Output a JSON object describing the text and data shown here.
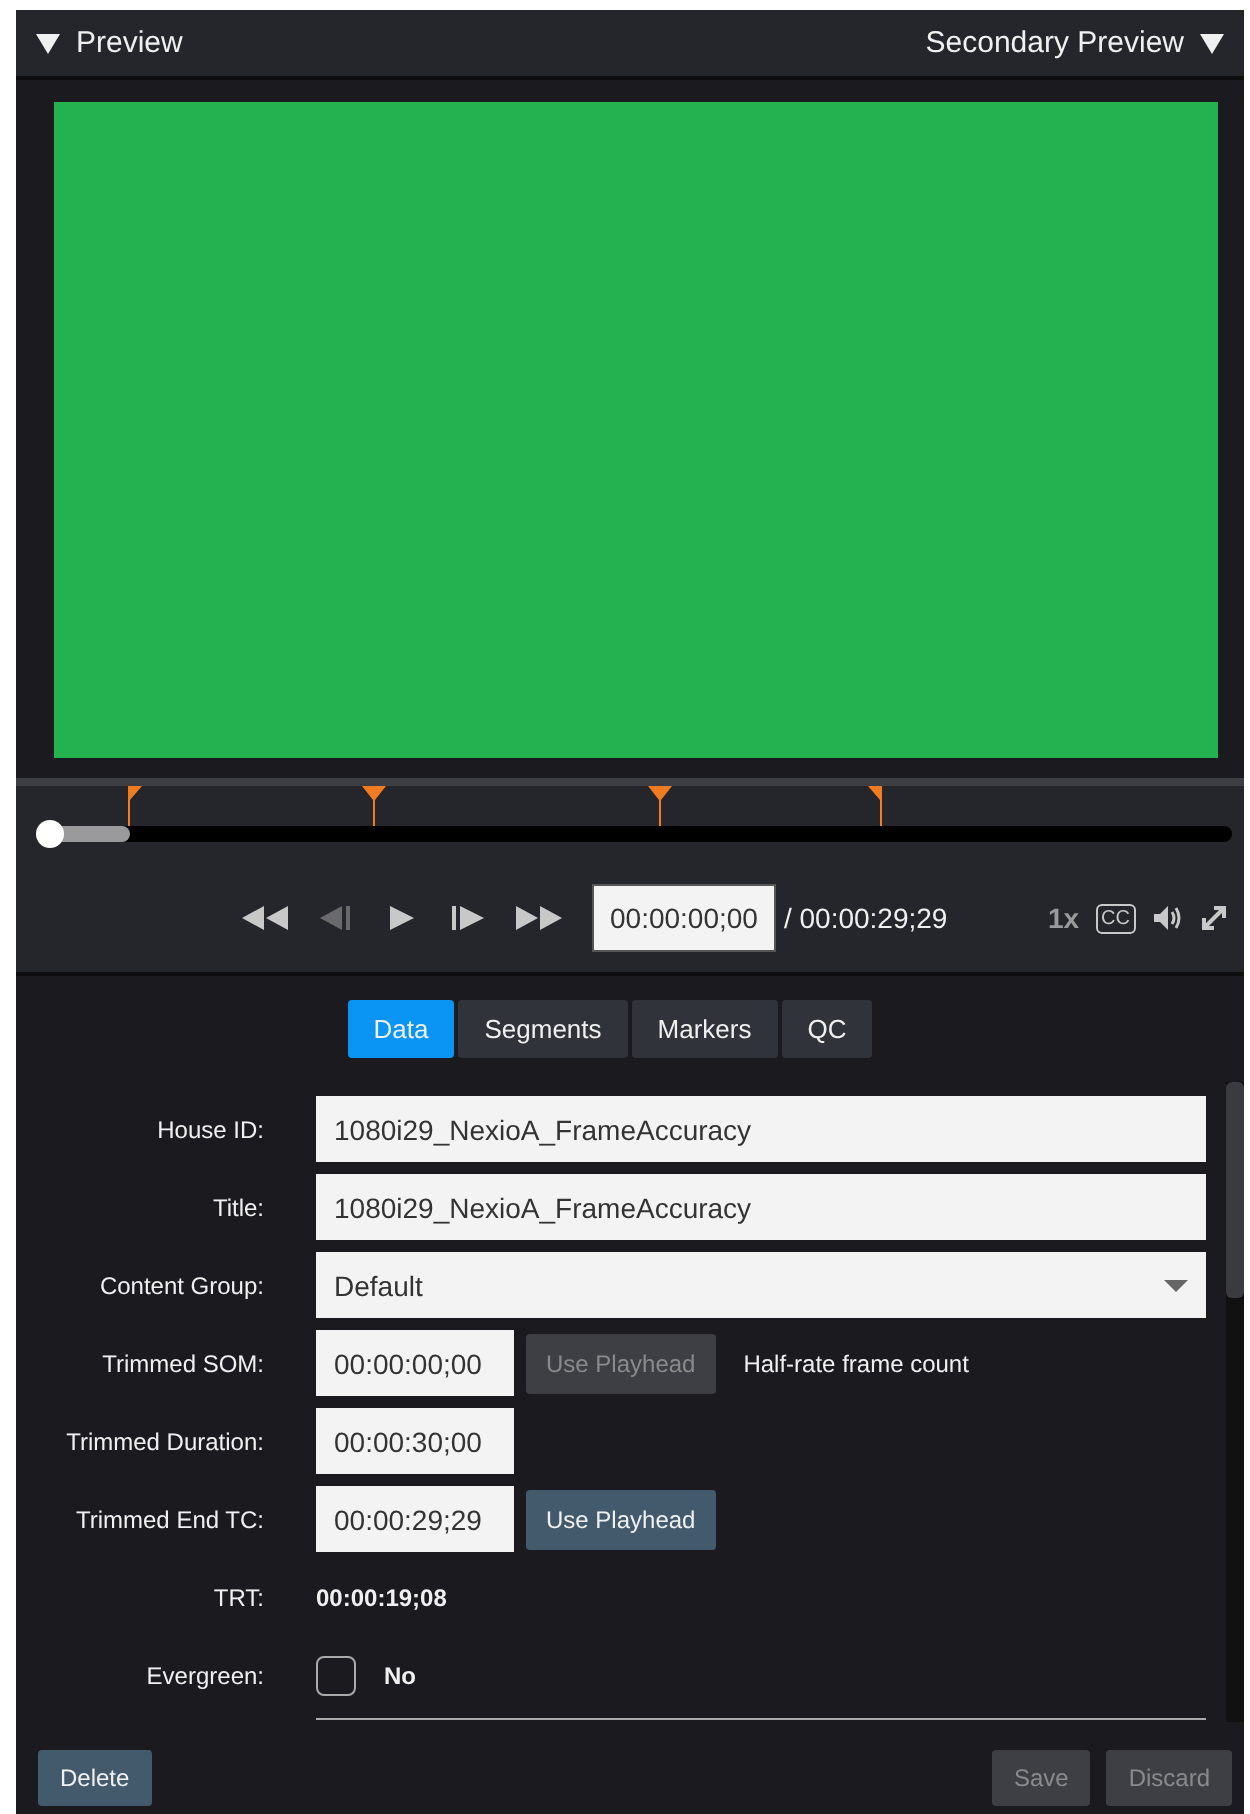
{
  "header": {
    "title": "Preview",
    "secondary": "Secondary Preview"
  },
  "timeline": {
    "level": 0.075,
    "markers": [
      {
        "kind": "in",
        "level": 0.075
      },
      {
        "kind": "point",
        "level": 0.28
      },
      {
        "kind": "point",
        "level": 0.52
      },
      {
        "kind": "out",
        "level": 0.705
      }
    ]
  },
  "transport": {
    "buttons": [
      {
        "kind": "rewind",
        "disabled": false
      },
      {
        "kind": "step-back",
        "disabled": true
      },
      {
        "kind": "play",
        "disabled": false
      },
      {
        "kind": "step-forward",
        "disabled": false
      },
      {
        "kind": "fast-forward",
        "disabled": false
      }
    ],
    "timecode": "00:00:00;00",
    "duration": "/ 00:00:29;29",
    "speed": "1x",
    "cc": "CC"
  },
  "tabs": [
    {
      "label": "Data",
      "selected": true
    },
    {
      "label": "Segments",
      "selected": false
    },
    {
      "label": "Markers",
      "selected": false
    },
    {
      "label": "QC",
      "selected": false
    }
  ],
  "fields": [
    {
      "kind": "text",
      "label": "House ID:",
      "value": "1080i29_NexioA_FrameAccuracy"
    },
    {
      "kind": "text",
      "label": "Title:",
      "value": "1080i29_NexioA_FrameAccuracy"
    },
    {
      "kind": "select",
      "label": "Content Group:",
      "value": "Default"
    },
    {
      "kind": "timecode",
      "label": "Trimmed SOM:",
      "value": "00:00:00;00",
      "button": {
        "label": "Use Playhead",
        "disabled": true
      },
      "note": "Half-rate frame count"
    },
    {
      "kind": "timecode",
      "label": "Trimmed Duration:",
      "value": "00:00:30;00"
    },
    {
      "kind": "timecode",
      "label": "Trimmed End TC:",
      "value": "00:00:29;29",
      "button": {
        "label": "Use Playhead",
        "disabled": false
      }
    },
    {
      "kind": "readonly",
      "label": "TRT:",
      "value": "00:00:19;08"
    },
    {
      "kind": "checkbox",
      "label": "Evergreen:",
      "value": "No",
      "checked": false
    }
  ],
  "footer": {
    "delete": {
      "label": "Delete",
      "disabled": false
    },
    "save": {
      "label": "Save",
      "disabled": true
    },
    "discard": {
      "label": "Discard",
      "disabled": true
    }
  }
}
